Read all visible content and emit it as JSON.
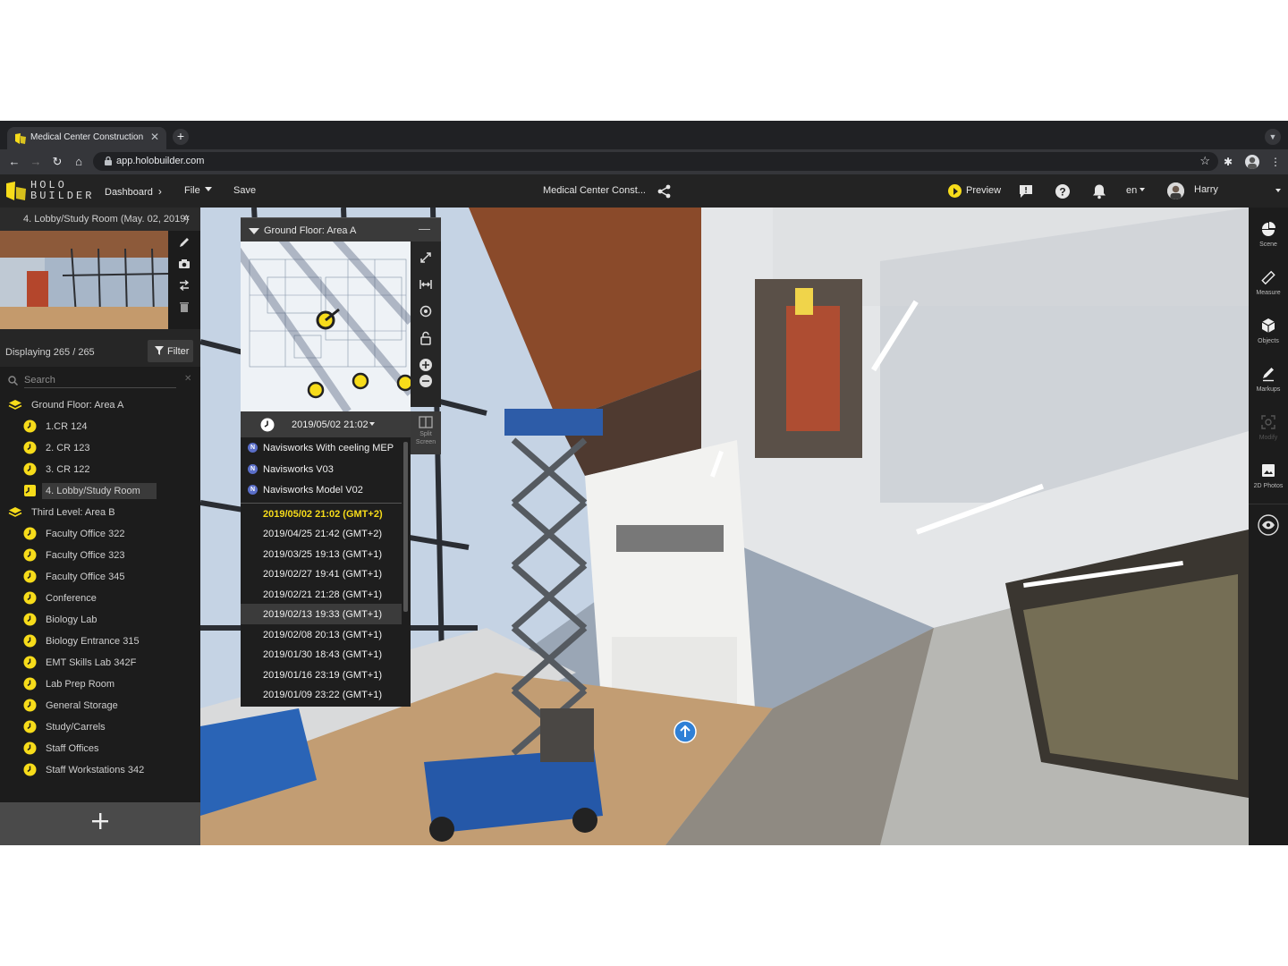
{
  "browser": {
    "tab_title": "Medical Center Construction",
    "tab_close": "✕",
    "new_tab": "+",
    "url": "app.holobuilder.com"
  },
  "app": {
    "logo_line1": "HOLO",
    "logo_line2": "BUILDER",
    "menu": {
      "dashboard": "Dashboard",
      "file": "File",
      "save": "Save"
    },
    "project_title": "Medical Center Const...",
    "preview": "Preview",
    "language": "en",
    "user": "Harry",
    "accent_color": "#f7dc1a"
  },
  "left_panel": {
    "scene_title": "4. Lobby/Study Room (May. 02, 2019)",
    "collapse": "«",
    "displaying": "Displaying 265 / 265",
    "filter": "Filter",
    "search_placeholder": "Search",
    "search_clear": "✕",
    "groups": [
      {
        "label": "Ground Floor: Area A",
        "items": [
          "1.CR 124",
          "2. CR 123",
          "3. CR 122",
          "4. Lobby/Study Room"
        ]
      },
      {
        "label": "Third Level: Area B",
        "items": [
          "Faculty Office 322",
          "Faculty Office 323",
          "Faculty Office 345",
          "Conference",
          "Biology Lab",
          "Biology Entrance 315",
          "EMT Skills Lab 342F",
          "Lab Prep Room",
          "General Storage",
          "Study/Carrels",
          "Staff Offices",
          "Staff Workstations 342"
        ]
      }
    ],
    "selected_item": "4. Lobby/Study Room"
  },
  "minimap": {
    "title": "Ground Floor: Area A",
    "minimize": "—"
  },
  "timeline": {
    "current": "2019/05/02 21:02",
    "bim_models": [
      "Navisworks With ceeling MEP",
      "Navisworks V03",
      "Navisworks Model V02"
    ],
    "bim_badge": "N",
    "captures": [
      "2019/05/02 21:02 (GMT+2)",
      "2019/04/25 21:42 (GMT+2)",
      "2019/03/25 19:13 (GMT+1)",
      "2019/02/27 19:41 (GMT+1)",
      "2019/02/21 21:28 (GMT+1)",
      "2019/02/13 19:33 (GMT+1)",
      "2019/02/08 20:13 (GMT+1)",
      "2019/01/30 18:43 (GMT+1)",
      "2019/01/16 23:19 (GMT+1)",
      "2019/01/09 23:22 (GMT+1)"
    ],
    "split_screen": "Split Screen"
  },
  "right_tools": {
    "scene": "Scene",
    "measure": "Measure",
    "objects": "Objects",
    "markups": "Markups",
    "modify": "Modify",
    "photos_2d": "2D Photos"
  }
}
